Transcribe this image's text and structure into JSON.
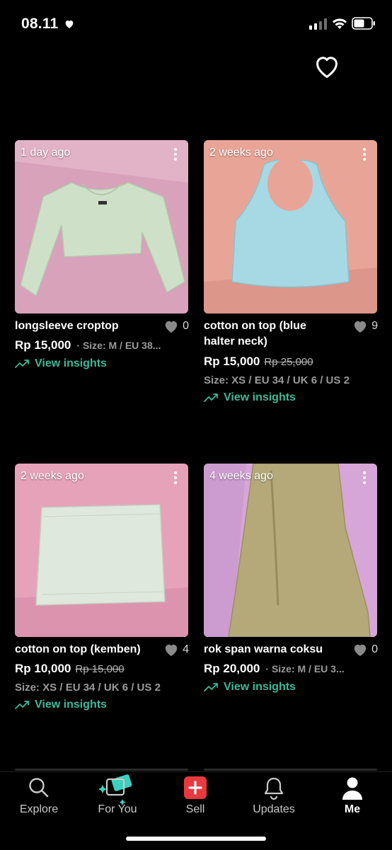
{
  "status_bar": {
    "time": "08.11"
  },
  "listings": [
    {
      "age": "1 day ago",
      "title": "longsleeve croptop",
      "likes": "0",
      "price": "Rp 15,000",
      "old_price": "",
      "size_inline": "· Size: M / EU 38...",
      "size_line": "",
      "insights": "View insights",
      "photo_bg": "#d8a0b8",
      "item_color": "#cfe0c8"
    },
    {
      "age": "2 weeks ago",
      "title_line1": "cotton on top (blue",
      "title_line2": "halter neck)",
      "likes": "9",
      "price": "Rp 15,000",
      "old_price": "Rp 25,000",
      "size_line": "Size: XS / EU 34 / UK 6 / US 2",
      "insights": "View insights",
      "photo_bg": "#e9a598",
      "item_color": "#a6d9e4"
    },
    {
      "age": "2 weeks ago",
      "title": "cotton on top (kemben)",
      "likes": "4",
      "price": "Rp 10,000",
      "old_price": "Rp 15,000",
      "size_line": "Size: XS / EU 34 / UK 6 / US 2",
      "insights": "View insights",
      "photo_bg": "#e6a2b9",
      "item_color": "#dfe8dd"
    },
    {
      "age": "4 weeks ago",
      "title": "rok span warna coksu",
      "likes": "0",
      "price": "Rp 20,000",
      "old_price": "",
      "size_inline": "· Size: M / EU 3...",
      "insights": "View insights",
      "photo_bg": "#d6a6d8",
      "item_color": "#b5a97a"
    }
  ],
  "tabs": [
    {
      "label": "Explore",
      "icon": "search-icon"
    },
    {
      "label": "For You",
      "icon": "for-you-icon"
    },
    {
      "label": "Sell",
      "icon": "plus-icon"
    },
    {
      "label": "Updates",
      "icon": "bell-icon"
    },
    {
      "label": "Me",
      "icon": "person-icon"
    }
  ],
  "colors": {
    "accent": "#3fb89a",
    "sell": "#e8393f",
    "background": "#000000"
  }
}
